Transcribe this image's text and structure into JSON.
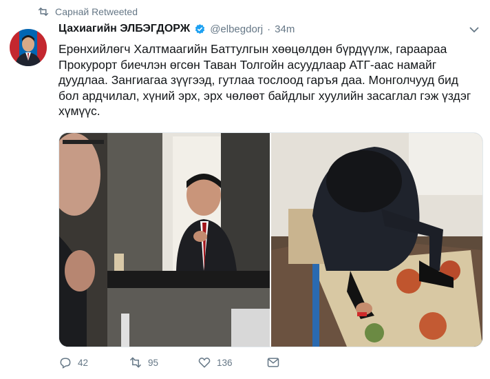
{
  "retweet": {
    "label": "Сарнай Retweeted"
  },
  "author": {
    "name": "Цахиагийн ЭЛБЭГДОРЖ",
    "handle": "@elbegdorj",
    "separator": "·",
    "time": "34m"
  },
  "tweet": {
    "text": "Ерөнхийлөгч Халтмаагийн Баттулгын хөөцөлдөн бүрдүүлж, гараараа Прокурорт биечлэн өгсөн Таван Толгойн асуудлаар АТГ-аас намайг дуудлаа. Зангиагаа зүүгээд, гутлаа тослоод гаръя даа. Монголчууд бид бол ардчилал, хүний эрх, эрх чөлөөт байдлыг хуулийн засаглал гэж үздэг хүмүүс."
  },
  "actions": {
    "replies": "42",
    "retweets": "95",
    "likes": "136"
  },
  "colors": {
    "text": "#14171a",
    "secondary": "#657786",
    "verified": "#1da1f2",
    "border": "#e1e8ed"
  },
  "icons": {
    "retweeted": "retweet-icon",
    "verified": "verified-badge-icon",
    "menu": "chevron-down-icon",
    "reply": "reply-icon",
    "retweet": "retweet-icon",
    "like": "heart-icon",
    "dm": "envelope-icon"
  }
}
